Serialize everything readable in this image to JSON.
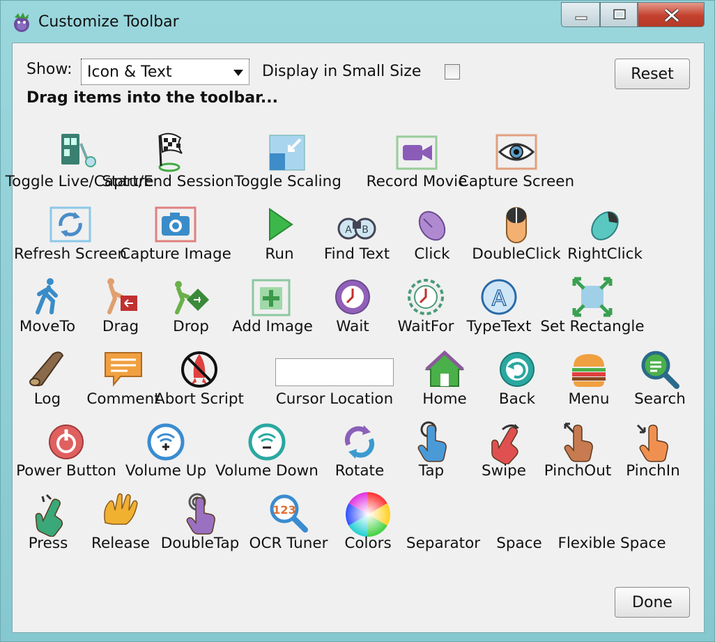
{
  "window": {
    "title": "Customize Toolbar"
  },
  "controls": {
    "show_label": "Show:",
    "show_value": "Icon & Text",
    "small_size_label": "Display in Small Size",
    "reset_label": "Reset",
    "done_label": "Done",
    "instructions": "Drag items into the toolbar..."
  },
  "items": [
    {
      "label": "Toggle Live/Capture",
      "icon": "toggle-live-capture-icon"
    },
    {
      "label": "Start/End Session",
      "icon": "checkered-flag-icon"
    },
    {
      "label": "Toggle Scaling",
      "icon": "scaling-icon"
    },
    {
      "label": "Record Movie",
      "icon": "video-camera-icon"
    },
    {
      "label": "Capture Screen",
      "icon": "eye-icon"
    },
    {
      "label": "Refresh Screen",
      "icon": "refresh-icon"
    },
    {
      "label": "Capture Image",
      "icon": "camera-icon"
    },
    {
      "label": "Run",
      "icon": "play-icon"
    },
    {
      "label": "Find Text",
      "icon": "binoculars-icon"
    },
    {
      "label": "Click",
      "icon": "mouse-click-icon"
    },
    {
      "label": "DoubleClick",
      "icon": "mouse-double-click-icon"
    },
    {
      "label": "RightClick",
      "icon": "mouse-right-click-icon"
    },
    {
      "label": "MoveTo",
      "icon": "walking-man-icon"
    },
    {
      "label": "Drag",
      "icon": "drag-icon"
    },
    {
      "label": "Drop",
      "icon": "drop-icon"
    },
    {
      "label": "Add Image",
      "icon": "add-image-icon"
    },
    {
      "label": "Wait",
      "icon": "clock-icon"
    },
    {
      "label": "WaitFor",
      "icon": "wait-for-icon"
    },
    {
      "label": "TypeText",
      "icon": "type-text-icon"
    },
    {
      "label": "Set Rectangle",
      "icon": "rectangle-arrows-icon"
    },
    {
      "label": "Log",
      "icon": "log-icon"
    },
    {
      "label": "Comment",
      "icon": "speech-bubble-icon"
    },
    {
      "label": "Abort Script",
      "icon": "abort-rocket-icon"
    },
    {
      "label": "Cursor Location",
      "icon": ""
    },
    {
      "label": "Home",
      "icon": "home-icon"
    },
    {
      "label": "Back",
      "icon": "back-arrow-icon"
    },
    {
      "label": "Menu",
      "icon": "burger-menu-icon"
    },
    {
      "label": "Search",
      "icon": "magnifier-icon"
    },
    {
      "label": "Power Button",
      "icon": "power-icon"
    },
    {
      "label": "Volume Up",
      "icon": "volume-up-icon"
    },
    {
      "label": "Volume Down",
      "icon": "volume-down-icon"
    },
    {
      "label": "Rotate",
      "icon": "rotate-icon"
    },
    {
      "label": "Tap",
      "icon": "tap-hand-icon"
    },
    {
      "label": "Swipe",
      "icon": "swipe-hand-icon"
    },
    {
      "label": "PinchOut",
      "icon": "pinch-out-icon"
    },
    {
      "label": "PinchIn",
      "icon": "pinch-in-icon"
    },
    {
      "label": "Press",
      "icon": "press-hand-icon"
    },
    {
      "label": "Release",
      "icon": "release-hand-icon"
    },
    {
      "label": "DoubleTap",
      "icon": "double-tap-icon"
    },
    {
      "label": "OCR Tuner",
      "icon": "ocr-magnifier-icon"
    },
    {
      "label": "Colors",
      "icon": "color-wheel-icon"
    },
    {
      "label": "Separator",
      "icon": ""
    },
    {
      "label": "Space",
      "icon": ""
    },
    {
      "label": "Flexible Space",
      "icon": ""
    }
  ]
}
